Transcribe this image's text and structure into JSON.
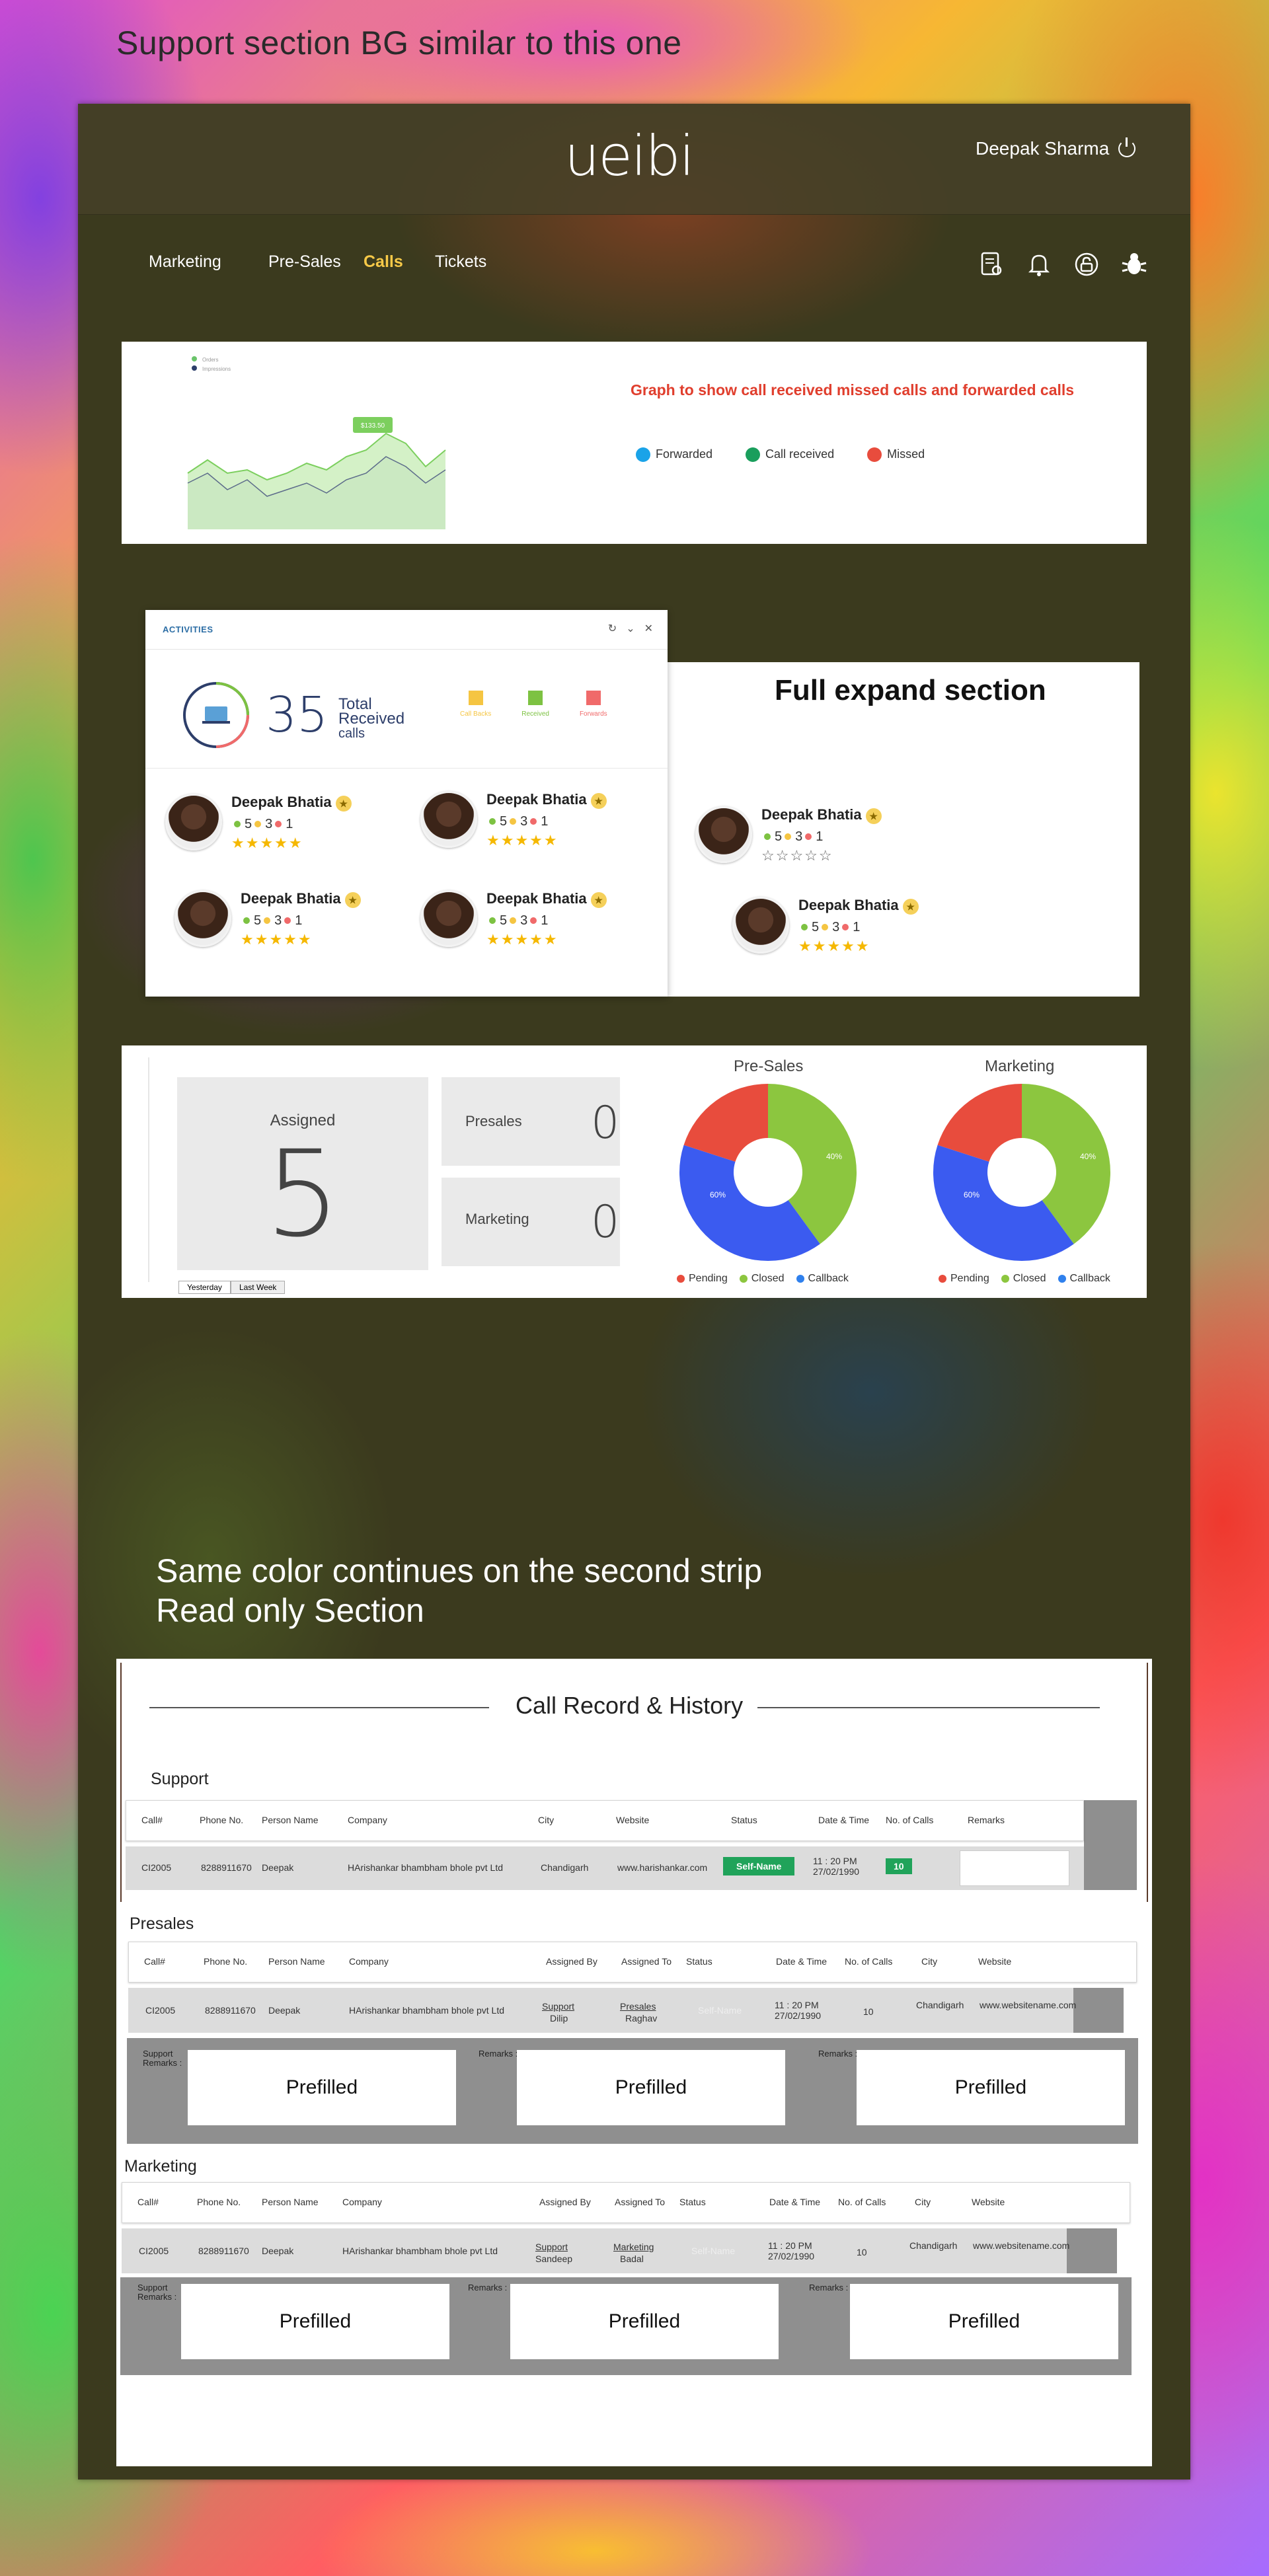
{
  "page_title": "Support section BG  similar to this one",
  "header": {
    "logo": "ueibi",
    "user_name": "Deepak Sharma"
  },
  "nav": {
    "items": [
      "Marketing",
      "Pre-Sales",
      "Calls",
      "Tickets"
    ],
    "active": "Calls",
    "icons": [
      "report-icon",
      "bell-icon",
      "lock-icon",
      "bug-icon"
    ]
  },
  "graph": {
    "legend_top": [
      "Orders",
      "Impressions"
    ],
    "tooltip": "$133.50",
    "title": "Graph  to show  call received missed calls and forwarded calls",
    "legend": [
      {
        "label": "Forwarded",
        "color": "#1aa3e8"
      },
      {
        "label": "Call received",
        "color": "#1a9e5c"
      },
      {
        "label": "Missed",
        "color": "#e84c3d"
      }
    ]
  },
  "activities": {
    "header": "ACTIVITIES",
    "total": "35",
    "total_label_1": "Total",
    "total_label_2": "Received",
    "total_label_3": "calls",
    "status_keys": [
      {
        "label": "Call Backs",
        "color": "#f5c542"
      },
      {
        "label": "Received",
        "color": "#7dc242"
      },
      {
        "label": "Forwards",
        "color": "#f06a6a"
      }
    ],
    "people": [
      {
        "name": "Deepak Bhatia",
        "green": "5",
        "yellow": "3",
        "red": "1",
        "stars": "★★★★★"
      },
      {
        "name": "Deepak Bhatia",
        "green": "5",
        "yellow": "3",
        "red": "1",
        "stars": "★★★★★"
      },
      {
        "name": "Deepak Bhatia",
        "green": "5",
        "yellow": "3",
        "red": "1",
        "stars": "★★★★★"
      },
      {
        "name": "Deepak Bhatia",
        "green": "5",
        "yellow": "3",
        "red": "1",
        "stars": "★★★★★"
      }
    ]
  },
  "expand": {
    "title": "Full expand section",
    "people": [
      {
        "name": "Deepak Bhatia",
        "green": "5",
        "yellow": "3",
        "red": "1",
        "stars": "☆☆☆☆☆"
      },
      {
        "name": "Deepak Bhatia",
        "green": "5",
        "yellow": "3",
        "red": "1",
        "stars": "★★★★★"
      }
    ]
  },
  "stats": {
    "assigned_label": "Assigned",
    "assigned_value": "5",
    "presales_label": "Presales",
    "presales_value": "0",
    "marketing_label": "Marketing",
    "marketing_value": "0",
    "tabs": [
      "Yesterday",
      "Last Week"
    ]
  },
  "pies": [
    {
      "title": "Pre-Sales",
      "labels": [
        "40%",
        "60%"
      ]
    },
    {
      "title": "Marketing",
      "labels": [
        "40%",
        "60%"
      ]
    }
  ],
  "pie_legend": [
    {
      "label": "Pending",
      "color": "#e84c3d"
    },
    {
      "label": "Closed",
      "color": "#8cc63f"
    },
    {
      "label": "Callback",
      "color": "#2f80ed"
    }
  ],
  "chart_data": [
    {
      "type": "pie",
      "title": "Pre-Sales",
      "slices": [
        {
          "label": "Closed",
          "value": 40,
          "color": "#8cc63f"
        },
        {
          "label": "Callback",
          "value": 40,
          "color": "#3b5bf0"
        },
        {
          "label": "Pending",
          "value": 20,
          "color": "#e84c3d"
        }
      ],
      "printed_labels": [
        "40%",
        "60%"
      ]
    },
    {
      "type": "pie",
      "title": "Marketing",
      "slices": [
        {
          "label": "Closed",
          "value": 40,
          "color": "#8cc63f"
        },
        {
          "label": "Callback",
          "value": 40,
          "color": "#3b5bf0"
        },
        {
          "label": "Pending",
          "value": 20,
          "color": "#e84c3d"
        }
      ],
      "printed_labels": [
        "40%",
        "60%"
      ]
    }
  ],
  "strip_text": {
    "line1": "Same color continues on the second strip",
    "line2": "Read only Section"
  },
  "history": {
    "title": "Call Record & History",
    "support": {
      "label": "Support",
      "columns": [
        "Call#",
        "Phone No.",
        "Person Name",
        "Company",
        "City",
        "Website",
        "Status",
        "Date & Time",
        "No. of Calls",
        "Remarks"
      ],
      "row": {
        "call": "CI2005",
        "phone": "8288911670",
        "person": "Deepak",
        "company": "HArishankar bhambham bhole  pvt Ltd",
        "city": "Chandigarh",
        "website": "www.harishankar.com",
        "status": "Self-Name",
        "date": "11 : 20 PM",
        "date2": "27/02/1990",
        "calls": "10"
      }
    },
    "presales": {
      "label": "Presales",
      "columns": [
        "Call#",
        "Phone No.",
        "Person Name",
        "Company",
        "Assigned By",
        "Assigned  To",
        "Status",
        "Date & Time",
        "No. of Calls",
        "City",
        "Website"
      ],
      "row": {
        "call": "CI2005",
        "phone": "8288911670",
        "person": "Deepak",
        "company": "HArishankar bhambham bhole  pvt Ltd",
        "by": "Support",
        "by_name": "Dilip",
        "to": "Presales",
        "to_name": "Raghav",
        "status": "Self-Name",
        "date": "11 : 20 PM",
        "date2": "27/02/1990",
        "calls": "10",
        "city": "Chandigarh",
        "website": "www.websitename.com"
      },
      "remarks": [
        {
          "label1": "Support",
          "label2": "Remarks :",
          "value": "Prefilled"
        },
        {
          "label1": "Remarks :",
          "label2": "",
          "value": "Prefilled"
        },
        {
          "label1": "Remarks :",
          "label2": "",
          "value": "Prefilled"
        }
      ]
    },
    "marketing": {
      "label": "Marketing",
      "columns": [
        "Call#",
        "Phone No.",
        "Person Name",
        "Company",
        "Assigned By",
        "Assigned  To",
        "Status",
        "Date & Time",
        "No. of Calls",
        "City",
        "Website"
      ],
      "row": {
        "call": "CI2005",
        "phone": "8288911670",
        "person": "Deepak",
        "company": "HArishankar bhambham bhole  pvt Ltd",
        "by": "Support",
        "by_name": "Sandeep",
        "to": "Marketing",
        "to_name": "Badal",
        "status": "Self-Name",
        "date": "11 : 20 PM",
        "date2": "27/02/1990",
        "calls": "10",
        "city": "Chandigarh",
        "website": "www.websitename.com"
      },
      "remarks": [
        {
          "label1": "Support",
          "label2": "Remarks :",
          "value": "Prefilled"
        },
        {
          "label1": "Remarks :",
          "label2": "",
          "value": "Prefilled"
        },
        {
          "label1": "Remarks :",
          "label2": "",
          "value": "Prefilled"
        }
      ]
    }
  }
}
